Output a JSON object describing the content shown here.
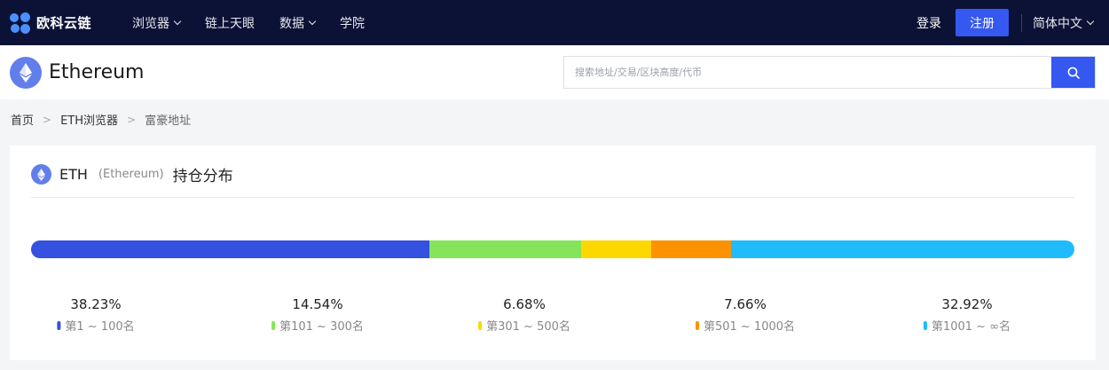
{
  "topbar": {
    "brand": "欧科云链",
    "nav": [
      {
        "label": "浏览器",
        "dropdown": true
      },
      {
        "label": "链上天眼",
        "dropdown": false
      },
      {
        "label": "数据",
        "dropdown": true
      },
      {
        "label": "学院",
        "dropdown": false
      }
    ],
    "login": "登录",
    "register": "注册",
    "language": "简体中文"
  },
  "header": {
    "coin_name": "Ethereum",
    "search_placeholder": "搜索地址/交易/区块高度/代币"
  },
  "breadcrumb": [
    "首页",
    "ETH浏览器",
    "富豪地址"
  ],
  "card": {
    "symbol": "ETH",
    "name": "(Ethereum)",
    "title": "持仓分布"
  },
  "chart_data": {
    "type": "bar",
    "stacked": true,
    "categories": [
      "第1 ~ 100名",
      "第101 ~ 300名",
      "第301 ~ 500名",
      "第501 ~ 1000名",
      "第1001 ~ ∞名"
    ],
    "values": [
      38.23,
      14.54,
      6.68,
      7.66,
      32.92
    ],
    "labels": [
      "38.23%",
      "14.54%",
      "6.68%",
      "7.66%",
      "32.92%"
    ],
    "colors": [
      "#3451e0",
      "#84e55a",
      "#fdd800",
      "#fd9200",
      "#1fbbfb"
    ]
  },
  "colors": {
    "topbar_bg": "#0b1235",
    "accent": "#3458f0",
    "eth": "#627eea"
  }
}
